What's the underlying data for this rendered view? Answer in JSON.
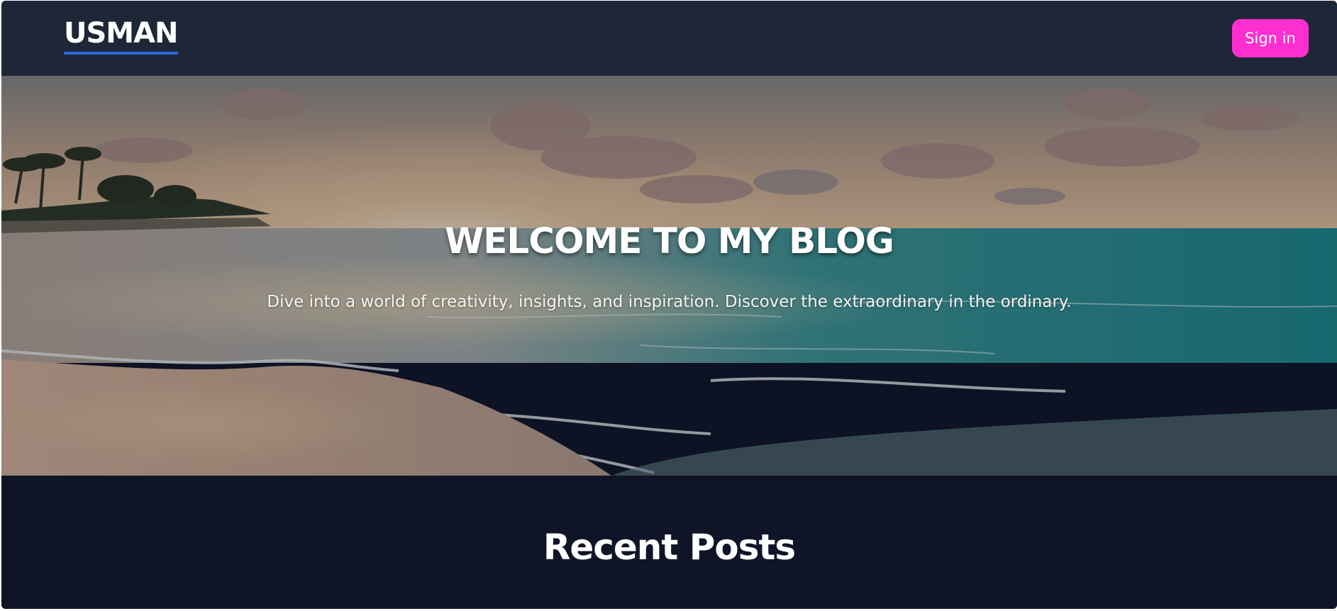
{
  "navbar": {
    "logo_text": "USMAN",
    "signin_label": "Sign in",
    "background": "#1e2738",
    "accent": "#ff2fcf",
    "logo_underline": "#2a6ae0"
  },
  "hero": {
    "title": "WELCOME TO MY BLOG",
    "subtitle": "Dive into a world of creativity, insights, and inspiration. Discover the extraordinary in the ordinary.",
    "image": "beach-sunset-image"
  },
  "recent": {
    "title": "Recent Posts",
    "background": "#0f1427"
  }
}
